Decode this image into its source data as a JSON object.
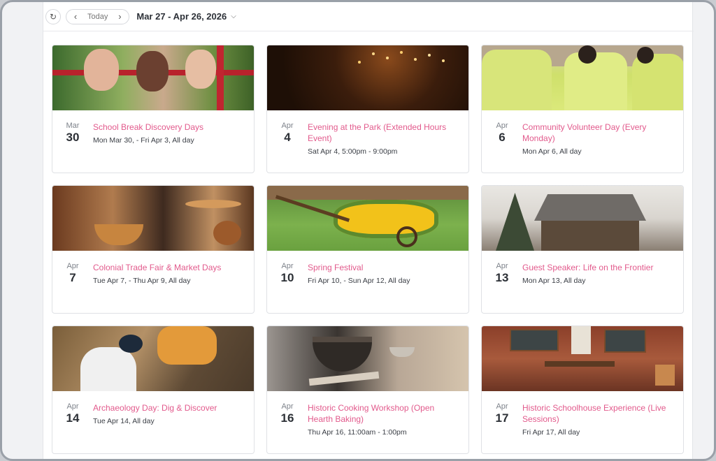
{
  "toolbar": {
    "refresh_icon": "refresh-icon",
    "today_label": "Today",
    "date_range": "Mar 27 - Apr 26, 2026"
  },
  "events": [
    {
      "month": "Mar",
      "day": "30",
      "title": "School Break Discovery Days",
      "when": "Mon Mar 30, - Fri Apr 3, All day",
      "image": "children-on-fence"
    },
    {
      "month": "Apr",
      "day": "4",
      "title": "Evening at the Park (Extended Hours Event)",
      "when": "Sat Apr 4, 5:00pm - 9:00pm",
      "image": "lights-at-night"
    },
    {
      "month": "Apr",
      "day": "6",
      "title": "Community Volunteer Day (Every Monday)",
      "when": "Mon Apr 6, All day",
      "image": "volunteers-shirts"
    },
    {
      "month": "Apr",
      "day": "7",
      "title": "Colonial Trade Fair & Market Days",
      "when": "Tue Apr 7, - Thu Apr 9, All day",
      "image": "copper-pots"
    },
    {
      "month": "Apr",
      "day": "10",
      "title": "Spring Festival",
      "when": "Fri Apr 10, - Sun Apr 12, All day",
      "image": "flower-wheelbarrow"
    },
    {
      "month": "Apr",
      "day": "13",
      "title": "Guest Speaker: Life on the Frontier",
      "when": "Mon Apr 13, All day",
      "image": "log-cabin"
    },
    {
      "month": "Apr",
      "day": "14",
      "title": "Archaeology Day: Dig & Discover",
      "when": "Tue Apr 14, All day",
      "image": "kids-digging"
    },
    {
      "month": "Apr",
      "day": "16",
      "title": "Historic Cooking Workshop (Open Hearth Baking)",
      "when": "Thu Apr 16, 11:00am - 1:00pm",
      "image": "hearth-pot"
    },
    {
      "month": "Apr",
      "day": "17",
      "title": "Historic Schoolhouse Experience (Live Sessions)",
      "when": "Fri Apr 17, All day",
      "image": "schoolhouse-interior"
    }
  ],
  "colors": {
    "accent": "#e25a8c",
    "text": "#2c3036"
  }
}
